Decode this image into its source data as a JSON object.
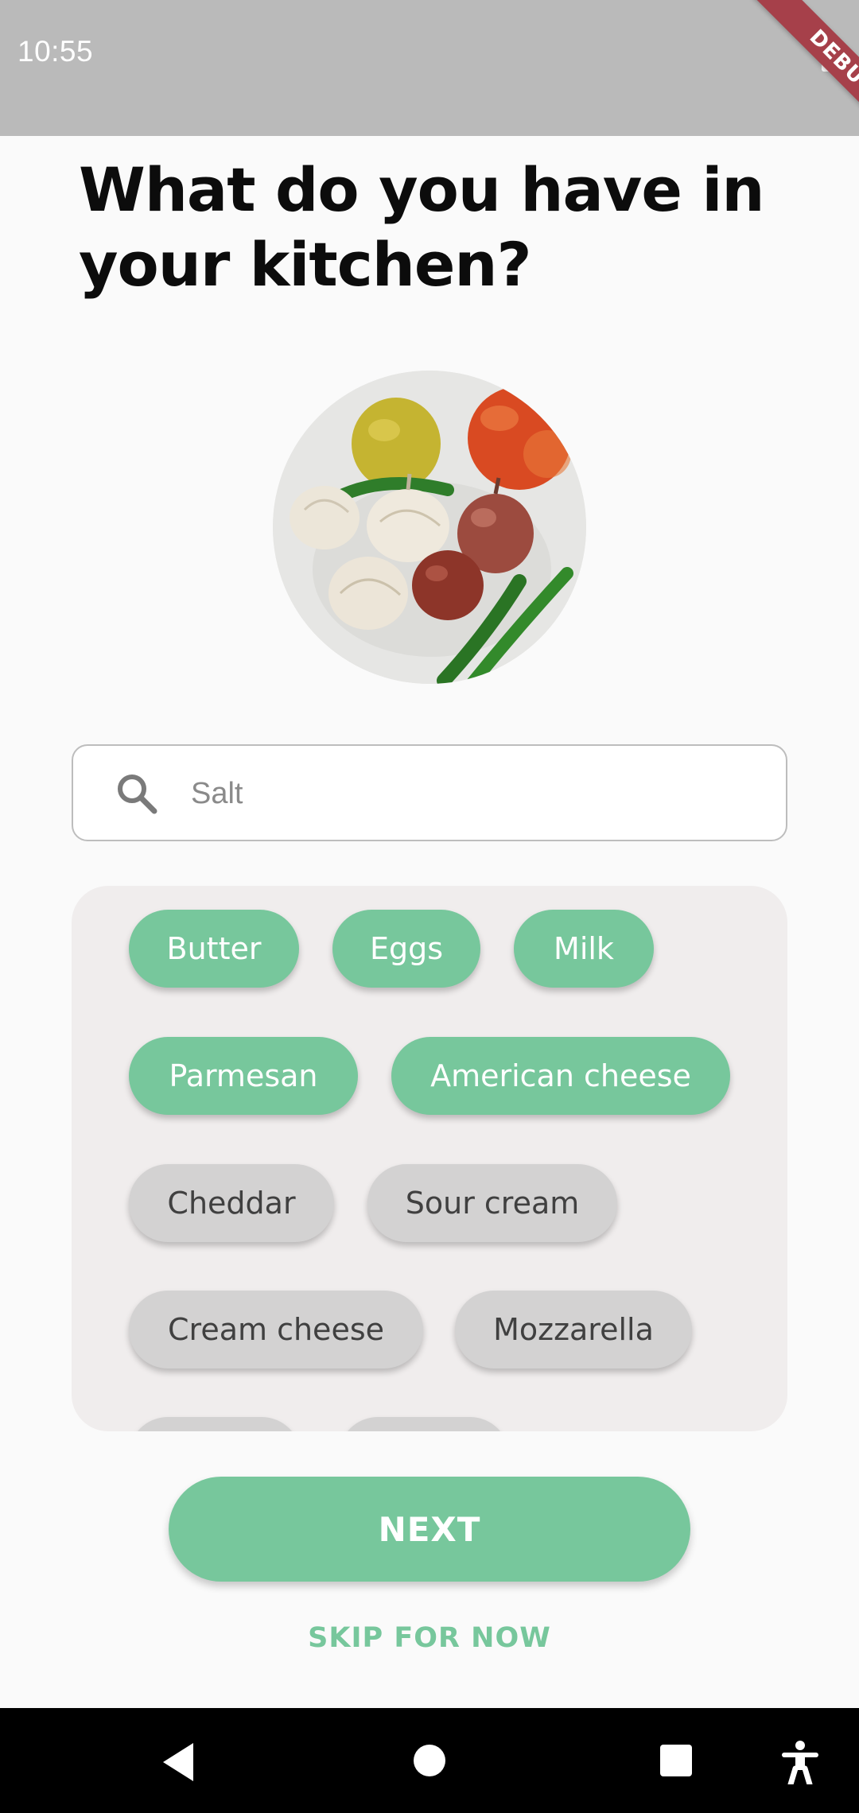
{
  "status_bar": {
    "time": "10:55",
    "battery_icon": "battery-full-icon"
  },
  "debug_banner": "DEBUG",
  "title": "What do you have in your kitchen?",
  "search": {
    "placeholder": "Salt",
    "value": "",
    "icon": "search-icon"
  },
  "ingredients": [
    {
      "label": "Butter",
      "selected": true
    },
    {
      "label": "Eggs",
      "selected": true
    },
    {
      "label": "Milk",
      "selected": true
    },
    {
      "label": "Parmesan",
      "selected": true
    },
    {
      "label": "American cheese",
      "selected": true
    },
    {
      "label": "Cheddar",
      "selected": false
    },
    {
      "label": "Sour cream",
      "selected": false
    },
    {
      "label": "Cream cheese",
      "selected": false
    },
    {
      "label": "Mozzarella",
      "selected": false
    }
  ],
  "buttons": {
    "next": "NEXT",
    "skip": "SKIP FOR NOW"
  },
  "colors": {
    "accent": "#77c79c",
    "chip_unselected": "#d3d2d2",
    "panel_bg": "#f0eded",
    "status_bar": "#bababa"
  },
  "nav_bar": {
    "icons": [
      "back-icon",
      "home-icon",
      "recent-apps-icon",
      "accessibility-icon"
    ]
  }
}
